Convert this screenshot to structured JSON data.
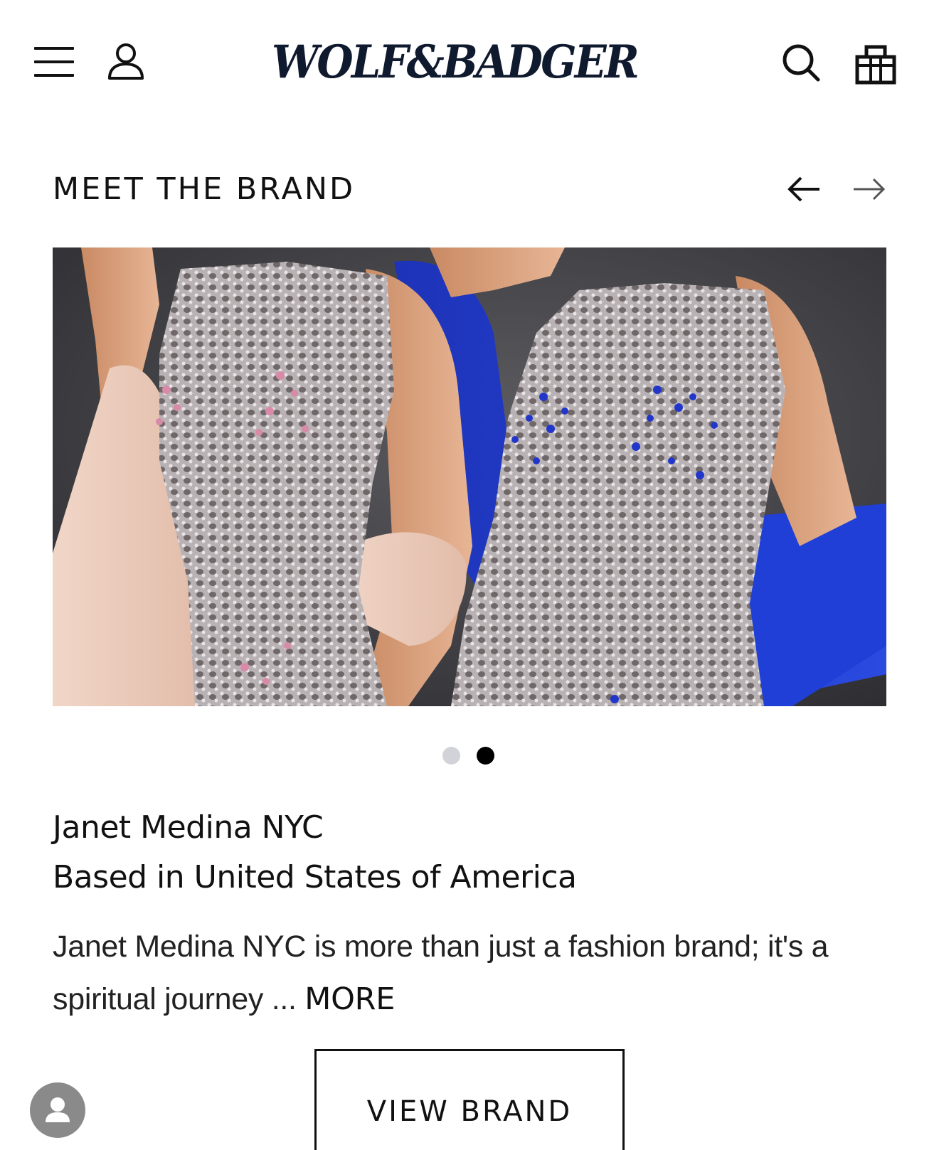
{
  "header": {
    "logo_text": "WOLF&BADGER",
    "menu_icon": "hamburger-menu-icon",
    "account_icon": "user-icon",
    "search_icon": "search-icon",
    "bag_icon": "shopping-bag-icon"
  },
  "section": {
    "title": "MEET THE BRAND",
    "prev_icon": "arrow-left-icon",
    "next_icon": "arrow-right-icon"
  },
  "carousel": {
    "image_alt": "",
    "total_slides": 2,
    "active_slide": 2
  },
  "brand": {
    "name": "Janet Medina NYC",
    "location": "Based in United States of America",
    "description": "Janet Medina NYC is more than just a fashion brand; it's a spiritual journey ...",
    "more_label": "MORE",
    "view_button_label": "VIEW BRAND"
  },
  "chat": {
    "avatar_icon": "user-avatar-icon"
  },
  "colors": {
    "logo": "#0f1a2e",
    "text": "#111111",
    "dot_inactive": "#d2d3d8",
    "dot_active": "#000000"
  }
}
